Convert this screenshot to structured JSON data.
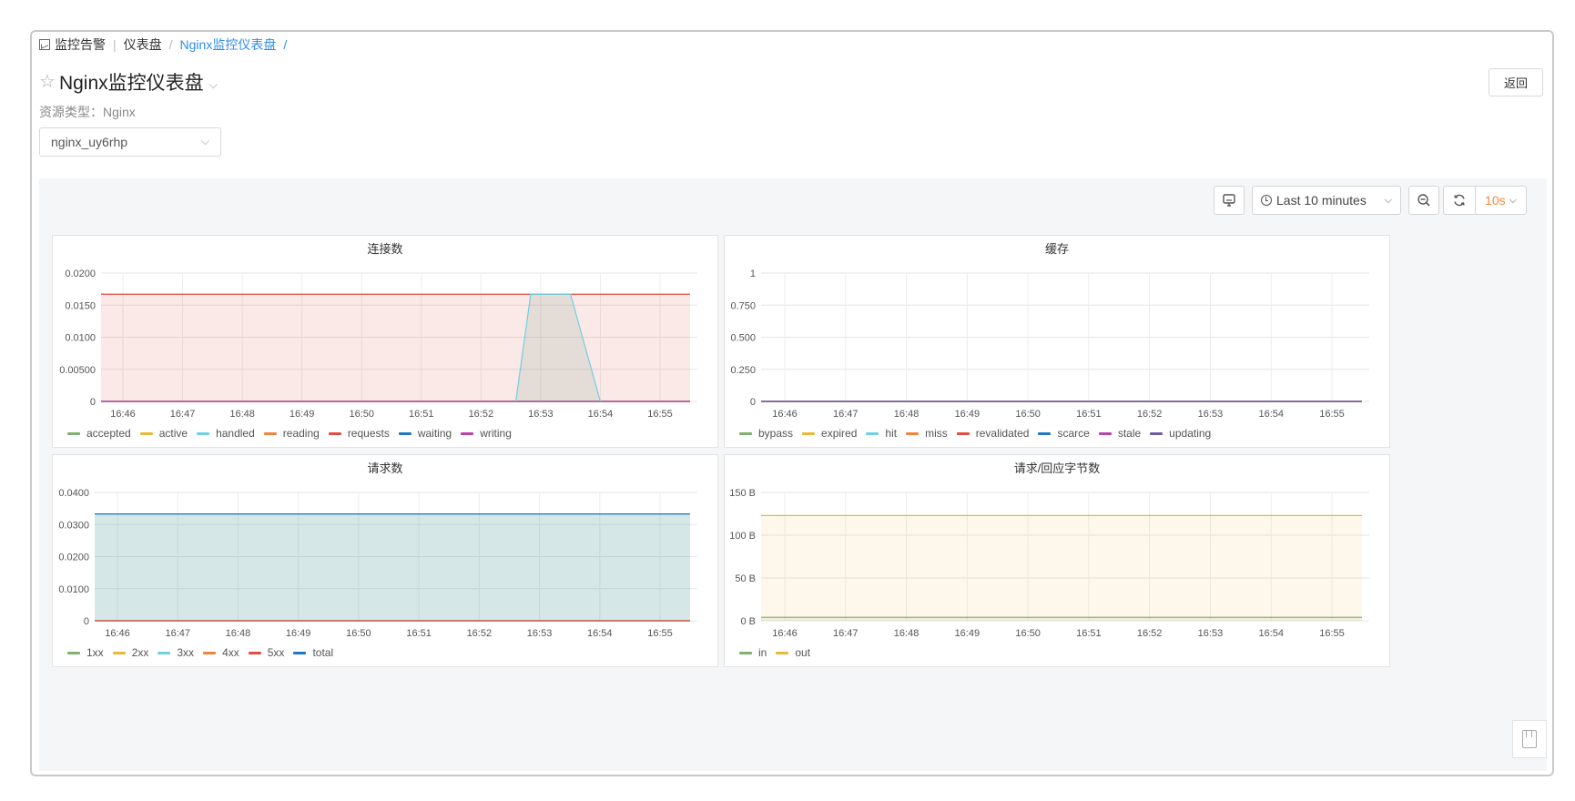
{
  "breadcrumb": {
    "items": [
      {
        "label": "监控告警",
        "icon": "chart-icon"
      },
      {
        "label": "仪表盘"
      },
      {
        "label": "Nginx监控仪表盘",
        "link": true
      }
    ],
    "trailing": "/"
  },
  "header": {
    "title": "Nginx监控仪表盘",
    "back_label": "返回",
    "resource_type": "资源类型：Nginx",
    "instance": "nginx_uy6rhp"
  },
  "toolbar": {
    "time_range": "Last 10 minutes",
    "refresh_interval": "10s"
  },
  "colors": {
    "green": "#7eb26d",
    "yellow": "#eab839",
    "cyan": "#6ed0e0",
    "orange": "#ef843c",
    "red": "#e24d42",
    "blue": "#1f78c1",
    "magenta": "#ba43a9",
    "purple": "#705da0",
    "interval_accent": "#f08a3c"
  },
  "chart_data": [
    {
      "type": "area",
      "title": "连接数",
      "x": [
        "16:46",
        "16:47",
        "16:48",
        "16:49",
        "16:50",
        "16:51",
        "16:52",
        "16:53",
        "16:54",
        "16:55"
      ],
      "yticks": [
        "0.0200",
        "0.0150",
        "0.0100",
        "0.00500",
        "0"
      ],
      "ylim": [
        0,
        0.02
      ],
      "series": [
        {
          "name": "accepted",
          "color": "#7eb26d",
          "flat": 0
        },
        {
          "name": "active",
          "color": "#eab839",
          "flat": 0
        },
        {
          "name": "handled",
          "color": "#6ed0e0",
          "flat": 0
        },
        {
          "name": "reading",
          "color": "#ef843c",
          "flat": 0
        },
        {
          "name": "requests",
          "color": "#e24d42",
          "flat": 0.0167
        },
        {
          "name": "waiting",
          "color": "#1f78c1",
          "flat": 0
        },
        {
          "name": "writing",
          "color": "#ba43a9",
          "flat": 0
        }
      ],
      "spike": {
        "series": "accepted",
        "points": [
          [
            "16:52:35",
            0
          ],
          [
            "16:52:50",
            0.0167
          ],
          [
            "16:53:30",
            0.0167
          ],
          [
            "16:54",
            0
          ]
        ]
      }
    },
    {
      "type": "line",
      "title": "缓存",
      "x": [
        "16:46",
        "16:47",
        "16:48",
        "16:49",
        "16:50",
        "16:51",
        "16:52",
        "16:53",
        "16:54",
        "16:55"
      ],
      "yticks": [
        "1",
        "0.750",
        "0.500",
        "0.250",
        "0"
      ],
      "ylim": [
        0,
        1
      ],
      "series": [
        {
          "name": "bypass",
          "color": "#7eb26d",
          "flat": 0
        },
        {
          "name": "expired",
          "color": "#eab839",
          "flat": 0
        },
        {
          "name": "hit",
          "color": "#6ed0e0",
          "flat": 0
        },
        {
          "name": "miss",
          "color": "#ef843c",
          "flat": 0
        },
        {
          "name": "revalidated",
          "color": "#e24d42",
          "flat": 0
        },
        {
          "name": "scarce",
          "color": "#1f78c1",
          "flat": 0
        },
        {
          "name": "stale",
          "color": "#ba43a9",
          "flat": 0
        },
        {
          "name": "updating",
          "color": "#705da0",
          "flat": 0
        }
      ]
    },
    {
      "type": "area",
      "title": "请求数",
      "x": [
        "16:46",
        "16:47",
        "16:48",
        "16:49",
        "16:50",
        "16:51",
        "16:52",
        "16:53",
        "16:54",
        "16:55"
      ],
      "yticks": [
        "0.0400",
        "0.0300",
        "0.0200",
        "0.0100",
        "0"
      ],
      "ylim": [
        0,
        0.04
      ],
      "series": [
        {
          "name": "1xx",
          "color": "#7eb26d",
          "flat": 0.0333
        },
        {
          "name": "2xx",
          "color": "#eab839",
          "flat": 0
        },
        {
          "name": "3xx",
          "color": "#6ed0e0",
          "flat": 0
        },
        {
          "name": "4xx",
          "color": "#ef843c",
          "flat": 0
        },
        {
          "name": "5xx",
          "color": "#e24d42",
          "flat": 0
        },
        {
          "name": "total",
          "color": "#1f78c1",
          "flat": 0.0333
        }
      ]
    },
    {
      "type": "area",
      "title": "请求/回应字节数",
      "x": [
        "16:46",
        "16:47",
        "16:48",
        "16:49",
        "16:50",
        "16:51",
        "16:52",
        "16:53",
        "16:54",
        "16:55"
      ],
      "yticks": [
        "150 B",
        "100 B",
        "50 B",
        "0 B"
      ],
      "ylim": [
        0,
        150
      ],
      "series": [
        {
          "name": "in",
          "color": "#7eb26d",
          "flat": 4
        },
        {
          "name": "out",
          "color": "#eab839",
          "flat": 123
        }
      ]
    }
  ]
}
